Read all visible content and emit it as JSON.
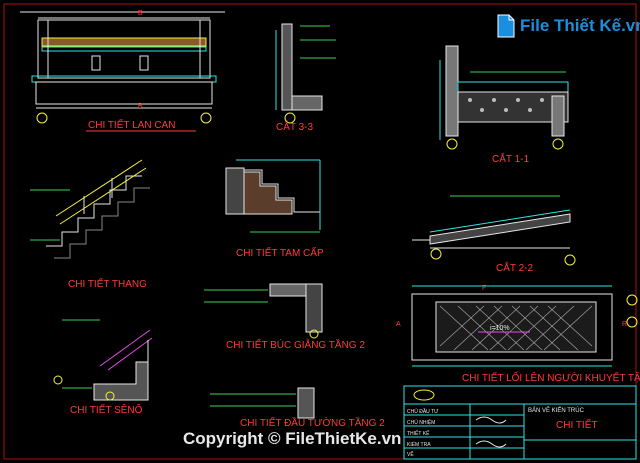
{
  "drawing": {
    "titles": {
      "railing": "CHI TIẾT LAN CAN",
      "section33": "CẮT 3-3",
      "section11": "CẮT 1-1",
      "stair": "CHI TIẾT THANG",
      "step": "CHI TIẾT TAM CẤP",
      "section22": "CẮT 2-2",
      "beam": "CHI TIẾT BÚC GIẰNG TẦNG 2",
      "access": "CHI TIẾT LỐI LÊN NGƯỜI KHUYẾT TẬT",
      "gutter": "CHI TIẾT SÊNÔ",
      "bottom": "CHI TIẾT ĐẦU TƯỜNG TẦNG 2"
    },
    "slope_label": "i=10%",
    "dim_labels": {
      "b": "B",
      "b2": "B",
      "a": "A",
      "f": "F",
      "r": "R"
    },
    "title_block": {
      "heading": "CHI TIẾT",
      "sheet_label": "BẢN VẼ KIẾN TRÚC",
      "role_rows": [
        "CHỦ ĐẦU TƯ",
        "CHỦ NHIỆM",
        "THIẾT KẾ",
        "KIỂM TRA",
        "VẼ"
      ]
    }
  },
  "watermark": {
    "brand": "File Thiết Kế.vn",
    "copyright": "Copyright © FileThietKe.vn"
  },
  "colors": {
    "background": "#000000",
    "title_red": "#ff3b3b",
    "line_white": "#e6e6e6",
    "line_cyan": "#2ee6e6",
    "line_yellow": "#f5f03c",
    "line_green": "#39d353",
    "line_magenta": "#e64ce6",
    "brand_blue": "#1a8fe0"
  }
}
